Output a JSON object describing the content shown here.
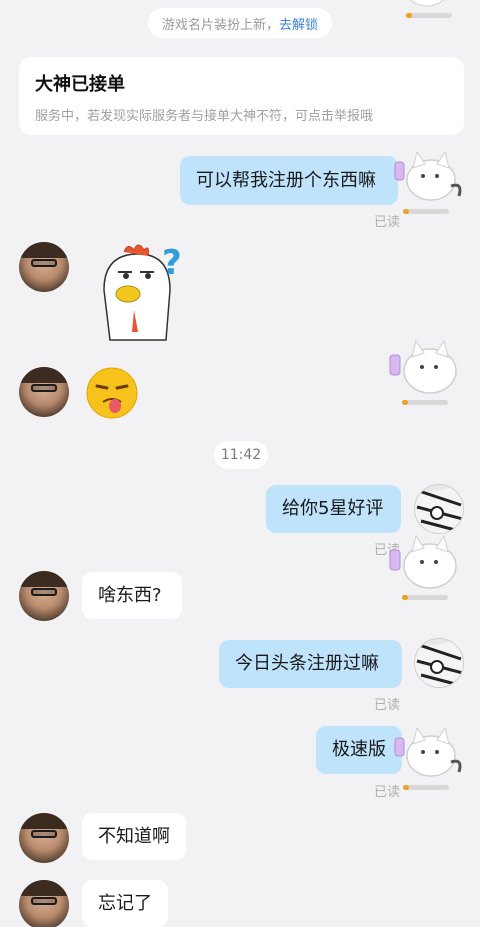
{
  "system_notice": {
    "text": "游戏名片装扮上新，",
    "link": "去解锁"
  },
  "status_card": {
    "title": "大神已接单",
    "description": "服务中，若发现实际服务者与接单大神不符，可点击举报哦"
  },
  "read_label": "已读",
  "timestamp": "11:42",
  "messages": [
    {
      "side": "mine",
      "text": "可以帮我注册个东西嘛"
    },
    {
      "side": "theirs",
      "sticker": "chicken-thinking-sticker"
    },
    {
      "side": "mine",
      "sticker": "cat-sticker"
    },
    {
      "side": "theirs",
      "sticker": "tongue-emoji-sticker"
    },
    {
      "side": "mine",
      "text": "给你5星好评"
    },
    {
      "side": "theirs",
      "text": "啥东西?"
    },
    {
      "side": "mine",
      "text": "今日头条注册过嘛"
    },
    {
      "side": "mine",
      "text": "极速版"
    },
    {
      "side": "theirs",
      "text": "不知道啊"
    },
    {
      "side": "theirs",
      "text": "忘记了"
    }
  ],
  "colors": {
    "background": "#f2f2f4",
    "mine_bubble": "#bfe3fb",
    "theirs_bubble": "#ffffff",
    "link": "#3d7df0"
  }
}
